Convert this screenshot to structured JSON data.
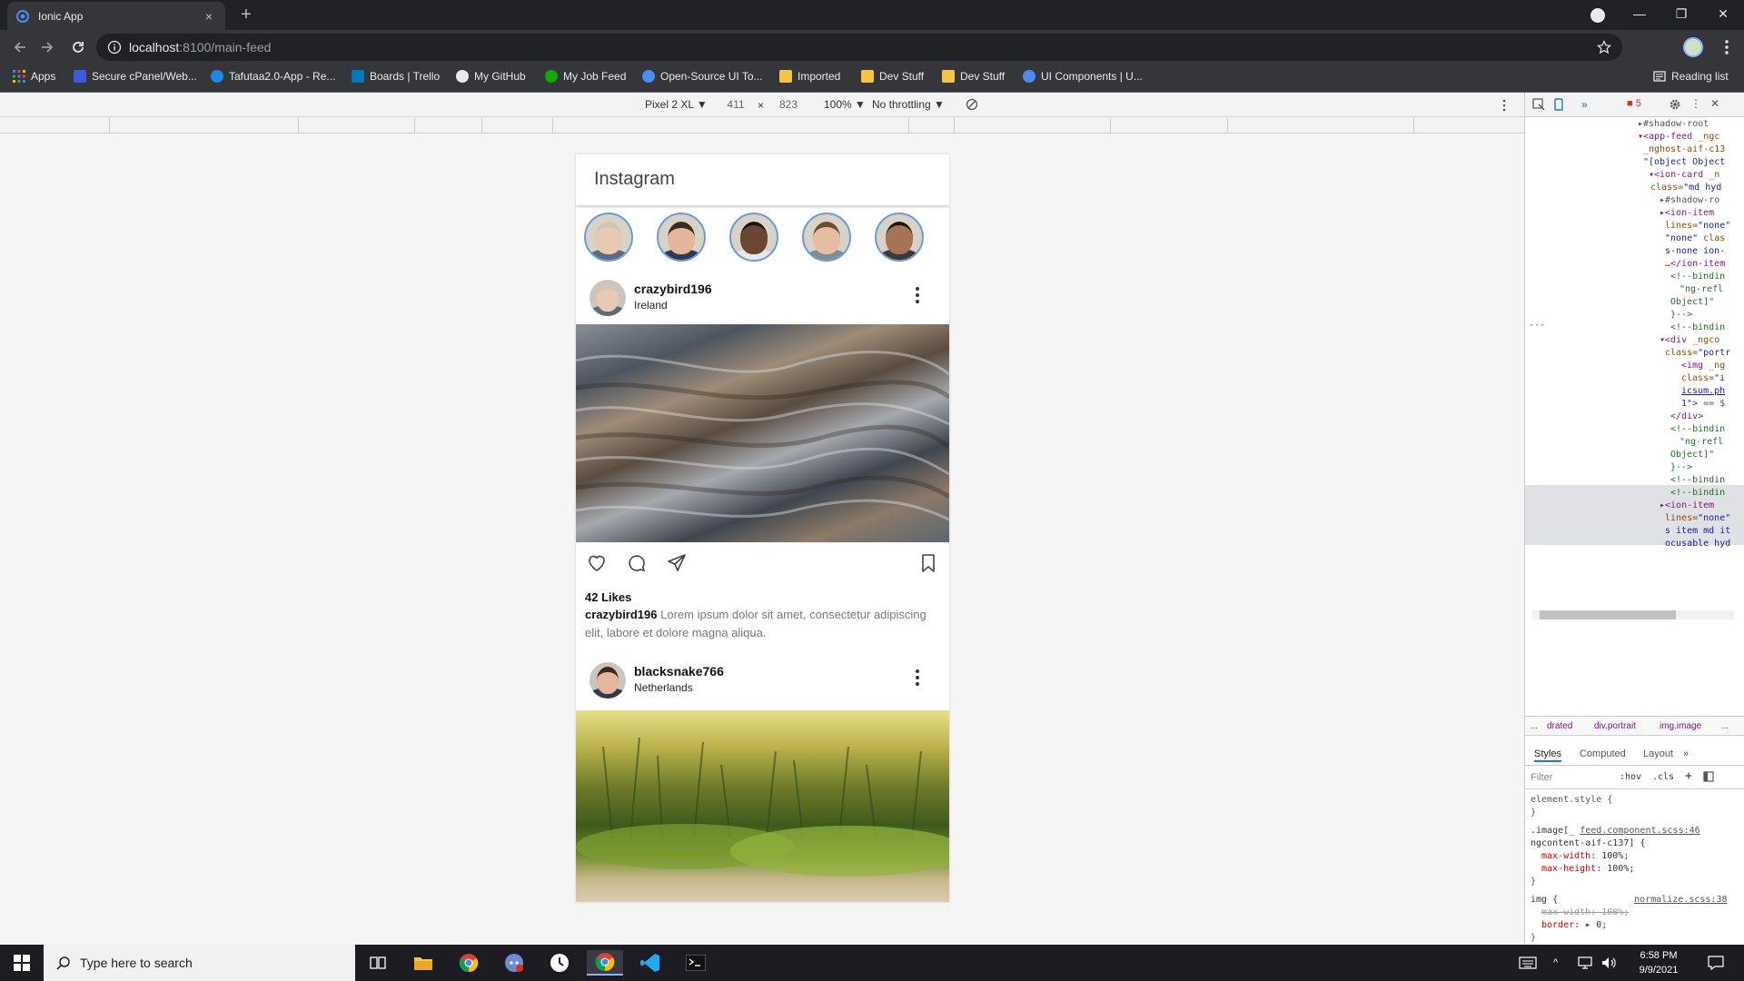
{
  "browser": {
    "tab_title": "Ionic App",
    "tab_close": "×",
    "new_tab": "+",
    "url_host": "localhost",
    "url_rest": ":8100/main-feed",
    "window_controls": [
      "—",
      "❐",
      "✕"
    ]
  },
  "bookmarks": [
    {
      "label": "Apps",
      "color": "#4285f4"
    },
    {
      "label": "Secure cPanel/Web...",
      "color": "#3b5bdb"
    },
    {
      "label": "Tafutaa2.0-App - Re...",
      "color": "#1e88e5"
    },
    {
      "label": "Boards | Trello",
      "color": "#0079bf"
    },
    {
      "label": "My GitHub",
      "color": "#e8eaed"
    },
    {
      "label": "My Job Feed",
      "color": "#14a800"
    },
    {
      "label": "Open-Source UI To...",
      "color": "#4c8bf5"
    },
    {
      "label": "Imported",
      "color": "#f6c443"
    },
    {
      "label": "Dev Stuff",
      "color": "#f6c443"
    },
    {
      "label": "Dev Stuff",
      "color": "#f6c443"
    },
    {
      "label": "UI Components | U...",
      "color": "#4c8bf5"
    }
  ],
  "reading_list": "Reading list",
  "device_toolbar": {
    "device": "Pixel 2 XL ▼",
    "width": "411",
    "times": "×",
    "height": "823",
    "zoom": "100% ▼",
    "throttle": "No throttling ▼"
  },
  "app": {
    "header_title": "Instagram",
    "stories": [
      {
        "skin": "#e9c9b3",
        "hair": "#cfc6b8",
        "shirt": "#5b6b7d"
      },
      {
        "skin": "#e2b79c",
        "hair": "#3b2a1f",
        "shirt": "#2d3a4f"
      },
      {
        "skin": "#6b4633",
        "hair": "#1d1410",
        "shirt": "#e9e9e9"
      },
      {
        "skin": "#e5bda1",
        "hair": "#6b4c33",
        "shirt": "#7e8c94"
      },
      {
        "skin": "#a57356",
        "hair": "#1d1410",
        "shirt": "#3a3a3a"
      }
    ],
    "posts": [
      {
        "username": "crazybird196",
        "location": "Ireland",
        "likes": "42 Likes",
        "caption_user": "crazybird196",
        "caption_text": "Lorem ipsum dolor sit amet, consectetur adipiscing elit, labore et dolore magna aliqua."
      },
      {
        "username": "blacksnake766",
        "location": "Netherlands"
      }
    ]
  },
  "devtools": {
    "errors": "5",
    "breadcrumbs": [
      "...",
      "drated",
      "div.portrait",
      "img.image",
      "..."
    ],
    "tabs": [
      "Styles",
      "Computed",
      "Layout",
      "»"
    ],
    "filter_placeholder": "Filter",
    "hov": ":hov",
    "cls": ".cls"
  },
  "taskbar": {
    "search_placeholder": "Type here to search",
    "time": "6:58 PM",
    "date": "9/9/2021"
  }
}
